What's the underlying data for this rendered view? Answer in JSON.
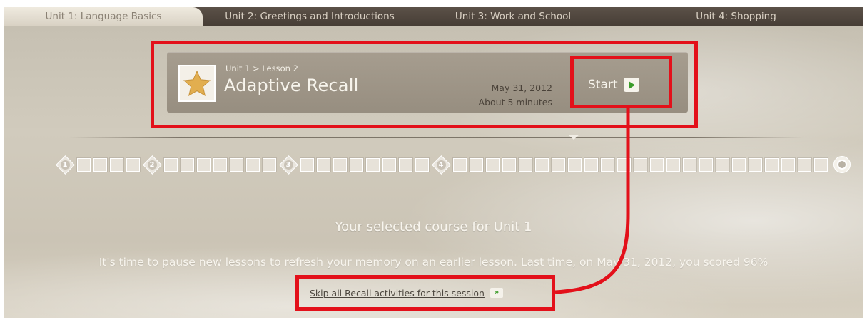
{
  "tabs": [
    {
      "label": "Unit 1: Language Basics",
      "active": true
    },
    {
      "label": "Unit 2: Greetings and Introductions",
      "active": false
    },
    {
      "label": "Unit 3: Work and School",
      "active": false
    },
    {
      "label": "Unit 4: Shopping",
      "active": false
    }
  ],
  "lesson": {
    "breadcrumb": "Unit 1 > Lesson 2",
    "title": "Adaptive Recall",
    "date": "May 31, 2012",
    "duration": "About 5 minutes",
    "start_label": "Start",
    "icon": "star-icon"
  },
  "progress": {
    "milestones": [
      "1",
      "2",
      "3",
      "4"
    ]
  },
  "main": {
    "headline": "Your selected course for Unit 1",
    "message": "It's time to pause new lessons to refresh your memory on an earlier lesson. Last time, on May 31, 2012, you scored 96%",
    "skip_label": "Skip all Recall activities for this session",
    "skip_icon_text": "»"
  },
  "colors": {
    "annotation": "#e3101a",
    "play_green": "#3c9c2a",
    "star": "#e2ae4f"
  }
}
